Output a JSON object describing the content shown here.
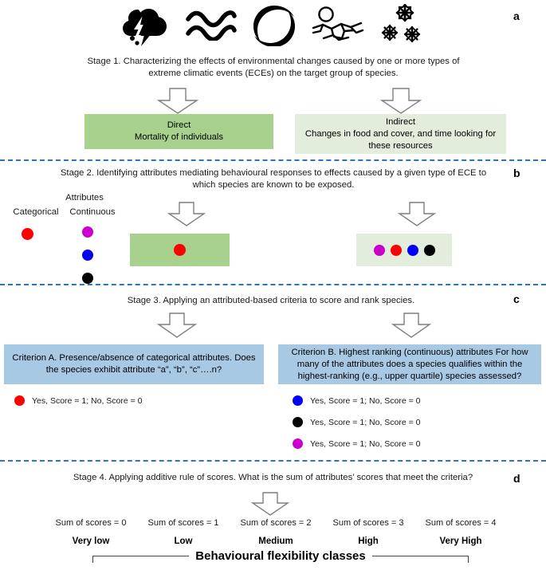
{
  "panels": {
    "a": "a",
    "b": "b",
    "c": "c",
    "d": "d"
  },
  "ece_icons": [
    {
      "name": "storm-cloud-lightning-icon",
      "label": "storm"
    },
    {
      "name": "heat-waves-icon",
      "label": "heat wave"
    },
    {
      "name": "hurricane-icon",
      "label": "hurricane"
    },
    {
      "name": "drought-sun-cracked-ground-icon",
      "label": "drought"
    },
    {
      "name": "snowflakes-icon",
      "label": "cold snap"
    }
  ],
  "stage1": {
    "caption": "Stage 1. Characterizing the effects of environmental changes caused by one or more types of extreme climatic events (ECEs) on the target group of species.",
    "direct": {
      "title": "Direct",
      "body": "Mortality of individuals"
    },
    "indirect": {
      "title": "Indirect",
      "body": "Changes in food and cover, and time looking for these resources"
    }
  },
  "stage2": {
    "caption": "Stage 2. Identifying attributes mediating behavioural responses to effects caused by a given type of ECE to which species are known to be exposed.",
    "attributes_title": "Attributes",
    "categorical_label": "Categorical",
    "continuous_label": "Continuous",
    "categorical_dots": [
      "#ff0000"
    ],
    "continuous_dots": [
      "#cc00cc",
      "#0000ff",
      "#000000"
    ],
    "direct_box_dots": [
      "#ff0000"
    ],
    "indirect_box_dots": [
      "#cc00cc",
      "#ff0000",
      "#0000ff",
      "#000000"
    ]
  },
  "stage3": {
    "caption": "Stage 3. Applying an attributed-based criteria to score and rank species.",
    "criterion_a": {
      "text": "Criterion A.  Presence/absence of categorical attributes. Does the species exhibit attribute “a”, “b”, “c”….n?",
      "scores": [
        {
          "color": "#ff0000",
          "text": "Yes, Score = 1; No, Score = 0"
        }
      ]
    },
    "criterion_b": {
      "text": "Criterion B. Highest ranking (continuous) attributes For how many of the attributes does a species qualifies within the highest-ranking (e.g., upper quartile) species assessed?",
      "scores": [
        {
          "color": "#0000ff",
          "text": "Yes, Score = 1; No, Score = 0"
        },
        {
          "color": "#000000",
          "text": "Yes, Score = 1; No, Score = 0"
        },
        {
          "color": "#cc00cc",
          "text": "Yes, Score = 1; No, Score = 0"
        }
      ]
    }
  },
  "stage4": {
    "caption": "Stage 4. Applying additive rule of scores. What is the sum of attributes’ scores that meet the criteria?",
    "columns": [
      {
        "sum": "Sum of scores = 0",
        "class": "Very low"
      },
      {
        "sum": "Sum of scores = 1",
        "class": "Low"
      },
      {
        "sum": "Sum of scores = 2",
        "class": "Medium"
      },
      {
        "sum": "Sum of scores = 3",
        "class": "High"
      },
      {
        "sum": "Sum of scores = 4",
        "class": "Very High"
      }
    ],
    "classes_title": "Behavioural flexibility classes"
  },
  "colors": {
    "green_dark": "#a8d18d",
    "green_light": "#e2eedb",
    "blue_box": "#a8c9e4",
    "separator": "#2e75b6",
    "arrow_outline": "#808080"
  }
}
